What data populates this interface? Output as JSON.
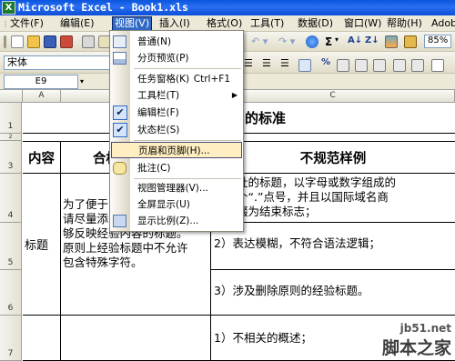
{
  "window": {
    "title": "Microsoft Excel - Book1.xls",
    "app_icon": "excel-icon"
  },
  "menubar": [
    "文件(F)",
    "编辑(E)",
    "视图(V)",
    "插入(I)",
    "格式(O)",
    "工具(T)",
    "数据(D)",
    "窗口(W)",
    "帮助(H)",
    "Adobe"
  ],
  "toolbar": {
    "font_name": "宋体",
    "sum_symbol": "Σ",
    "percent_symbol": "%"
  },
  "name_box": "E9",
  "columns": [
    "A",
    "C"
  ],
  "rows": [
    "1",
    "2",
    "3",
    "4",
    "5",
    "6",
    "7"
  ],
  "sheet": {
    "title_fragment": "的标准",
    "header_content": "内容",
    "header_col2_fragment": "合格",
    "header_bad_examples": "不规范样例",
    "label_title": "标题",
    "rule_lines": [
      "为了便于",
      "请尽量添",
      "够反映经验内容的标题。",
      "原则上经验标题中不允许",
      "包含特殊字符。"
    ],
    "example1": [
      "有网址的标题，以字母或数字组成的",
      "上一个“.”点号，并且以国际域名商",
      "的后缀为结束标志；"
    ],
    "example2": "2）表达模糊，不符合语法逻辑；",
    "example3": "3）涉及删除原则的经验标题。",
    "example4": "1）不相关的概述；"
  },
  "view_menu": {
    "items": [
      {
        "label": "普通(N)",
        "icon": "normal-view-icon",
        "checked": false
      },
      {
        "label": "分页预览(P)",
        "icon": "page-break-preview-icon",
        "checked": false
      },
      {
        "label": "任务窗格(K)",
        "shortcut": "Ctrl+F1",
        "checked": false
      },
      {
        "label": "工具栏(T)",
        "submenu": true,
        "checked": false
      },
      {
        "label": "编辑栏(F)",
        "checked": true
      },
      {
        "label": "状态栏(S)",
        "checked": true
      },
      {
        "label": "页眉和页脚(H)...",
        "highlighted": true
      },
      {
        "label": "批注(C)",
        "icon": "comment-icon"
      },
      {
        "label": "视图管理器(V)..."
      },
      {
        "label": "全屏显示(U)"
      },
      {
        "label": "显示比例(Z)...",
        "icon": "zoom-icon"
      }
    ]
  },
  "watermark": {
    "line1": "jb51.net",
    "line2": "脚本之家"
  }
}
